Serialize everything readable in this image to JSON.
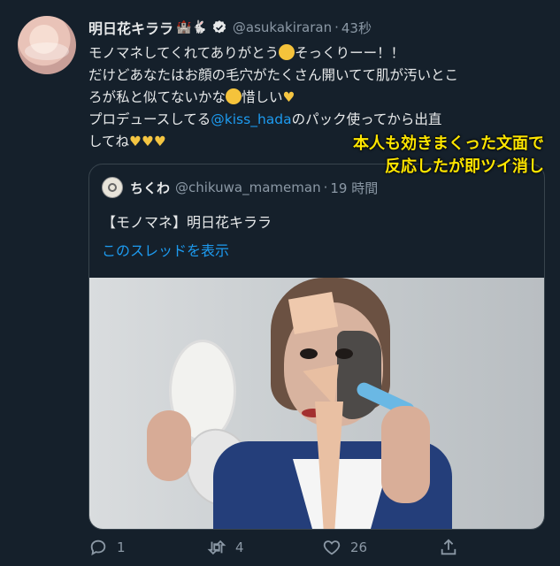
{
  "author": {
    "name": "明日花キララ",
    "name_emoji": "🏰🐇",
    "handle": "@asukakiraran",
    "time": "43秒"
  },
  "body": {
    "line1_a": "モノマネしてくれてありがとう",
    "line1_b": "そっくりーー！！",
    "line2": "だけどあなたはお顔の毛穴がたくさん開いてて肌が汚いとこ",
    "line3_a": "ろが私と似てないかな",
    "line3_b": "惜しい",
    "line4_a": "プロデュースしてる",
    "line4_mention": "@kiss_hada",
    "line4_b": "のパック使ってから出直",
    "line5": "してね",
    "hearts": "💛💛💛"
  },
  "caption_overlay": {
    "line1": "本人も効きまくった文面で",
    "line2": "反応したが即ツイ消し"
  },
  "quoted": {
    "name": "ちくわ",
    "handle": "@chikuwa_mameman",
    "time": "19 時間",
    "title": "【モノマネ】明日花キララ",
    "thread_link": "このスレッドを表示"
  },
  "actions": {
    "replies": "1",
    "retweets": "4",
    "likes": "26"
  },
  "colors": {
    "background": "#15202b",
    "accent": "#1d9bf0",
    "overlay_text": "#ffe600"
  }
}
